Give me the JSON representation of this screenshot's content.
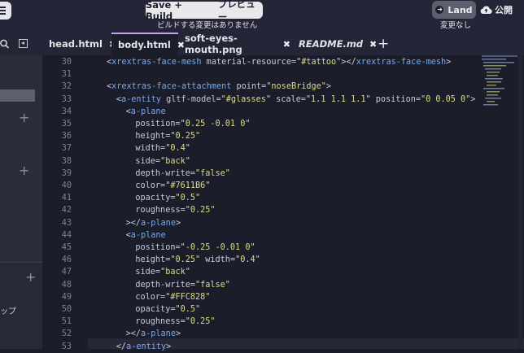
{
  "topbar": {
    "save_label": "Save + Build",
    "preview_label": "プレビュー",
    "build_status": "ビルドする変更はありません",
    "land_label": "Land",
    "publish_label": "公開",
    "land_status": "変更なし"
  },
  "sidebar": {
    "bottom_text": "ップ"
  },
  "tabs": [
    {
      "label": "head.html"
    },
    {
      "label": "body.html"
    },
    {
      "label": "soft-eyes-mouth.png"
    },
    {
      "label": "README.md"
    }
  ],
  "code_lines": [
    {
      "n": "30",
      "indent": 0,
      "parts": [
        [
          "p",
          "<"
        ],
        [
          "tag",
          "xrextras-face-mesh"
        ],
        [
          "attr",
          " material-resource="
        ],
        [
          "str",
          "\"#tattoo\""
        ],
        [
          "p",
          ">"
        ],
        [
          "p",
          "</"
        ],
        [
          "tag",
          "xrextras-face-mesh"
        ],
        [
          "p",
          ">"
        ]
      ]
    },
    {
      "n": "31",
      "indent": 0,
      "parts": []
    },
    {
      "n": "32",
      "indent": 0,
      "parts": [
        [
          "p",
          "<"
        ],
        [
          "tag",
          "xrextras-face-attachment"
        ],
        [
          "attr",
          " point="
        ],
        [
          "str",
          "\"noseBridge\""
        ],
        [
          "p",
          ">"
        ]
      ]
    },
    {
      "n": "33",
      "indent": 1,
      "parts": [
        [
          "p",
          "<"
        ],
        [
          "tag",
          "a-entity"
        ],
        [
          "attr",
          " gltf-model="
        ],
        [
          "str",
          "\"#glasses\""
        ],
        [
          "attr",
          " scale="
        ],
        [
          "str",
          "\"1.1 1.1 1.1\""
        ],
        [
          "attr",
          " position="
        ],
        [
          "str",
          "\"0 0.05 0\""
        ],
        [
          "p",
          ">"
        ]
      ]
    },
    {
      "n": "34",
      "indent": 2,
      "parts": [
        [
          "p",
          "<"
        ],
        [
          "tag",
          "a-plane"
        ]
      ]
    },
    {
      "n": "35",
      "indent": 3,
      "parts": [
        [
          "attr",
          "position="
        ],
        [
          "str",
          "\"0.25 -0.01 0\""
        ]
      ]
    },
    {
      "n": "36",
      "indent": 3,
      "parts": [
        [
          "attr",
          "height="
        ],
        [
          "str",
          "\"0.25\""
        ]
      ]
    },
    {
      "n": "37",
      "indent": 3,
      "parts": [
        [
          "attr",
          "width="
        ],
        [
          "str",
          "\"0.4\""
        ]
      ]
    },
    {
      "n": "38",
      "indent": 3,
      "parts": [
        [
          "attr",
          "side="
        ],
        [
          "str",
          "\"back\""
        ]
      ]
    },
    {
      "n": "39",
      "indent": 3,
      "parts": [
        [
          "attr",
          "depth-write="
        ],
        [
          "str",
          "\"false\""
        ]
      ]
    },
    {
      "n": "40",
      "indent": 3,
      "parts": [
        [
          "attr",
          "color="
        ],
        [
          "str",
          "\"#7611B6\""
        ]
      ]
    },
    {
      "n": "41",
      "indent": 3,
      "parts": [
        [
          "attr",
          "opacity="
        ],
        [
          "str",
          "\"0.5\""
        ]
      ]
    },
    {
      "n": "42",
      "indent": 3,
      "parts": [
        [
          "attr",
          "roughness="
        ],
        [
          "str",
          "\"0.25\""
        ]
      ]
    },
    {
      "n": "43",
      "indent": 2,
      "parts": [
        [
          "p",
          ">"
        ],
        [
          "p",
          "</"
        ],
        [
          "tag",
          "a-plane"
        ],
        [
          "p",
          ">"
        ]
      ]
    },
    {
      "n": "44",
      "indent": 2,
      "parts": [
        [
          "p",
          "<"
        ],
        [
          "tag",
          "a-plane"
        ]
      ]
    },
    {
      "n": "45",
      "indent": 3,
      "parts": [
        [
          "attr",
          "position="
        ],
        [
          "str",
          "\"-0.25 -0.01 0\""
        ]
      ]
    },
    {
      "n": "46",
      "indent": 3,
      "parts": [
        [
          "attr",
          "height="
        ],
        [
          "str",
          "\"0.25\""
        ],
        [
          "attr",
          " width="
        ],
        [
          "str",
          "\"0.4\""
        ]
      ]
    },
    {
      "n": "47",
      "indent": 3,
      "parts": [
        [
          "attr",
          "side="
        ],
        [
          "str",
          "\"back\""
        ]
      ]
    },
    {
      "n": "48",
      "indent": 3,
      "parts": [
        [
          "attr",
          "depth-write="
        ],
        [
          "str",
          "\"false\""
        ]
      ]
    },
    {
      "n": "49",
      "indent": 3,
      "parts": [
        [
          "attr",
          "color="
        ],
        [
          "str",
          "\"#FFC828\""
        ]
      ]
    },
    {
      "n": "50",
      "indent": 3,
      "parts": [
        [
          "attr",
          "opacity="
        ],
        [
          "str",
          "\"0.5\""
        ]
      ]
    },
    {
      "n": "51",
      "indent": 3,
      "parts": [
        [
          "attr",
          "roughness="
        ],
        [
          "str",
          "\"0.25\""
        ]
      ]
    },
    {
      "n": "52",
      "indent": 2,
      "parts": [
        [
          "p",
          ">"
        ],
        [
          "p",
          "</"
        ],
        [
          "tag",
          "a-plane"
        ],
        [
          "p",
          ">"
        ]
      ]
    },
    {
      "n": "53",
      "indent": 1,
      "parts": [
        [
          "p",
          "</"
        ],
        [
          "tag",
          "a-entity"
        ],
        [
          "p",
          ">"
        ]
      ]
    }
  ],
  "colors": {
    "tag": "#7aa9e8",
    "string": "#d9dc8a",
    "attribute": "#c7ccd8",
    "active_tab_accent": "#c5a3f4"
  },
  "icons": [
    "menu-icon",
    "arrow-circle-icon",
    "cloud-upload-icon",
    "search-icon",
    "collapse-icon",
    "plus-icon",
    "close-icon"
  ]
}
